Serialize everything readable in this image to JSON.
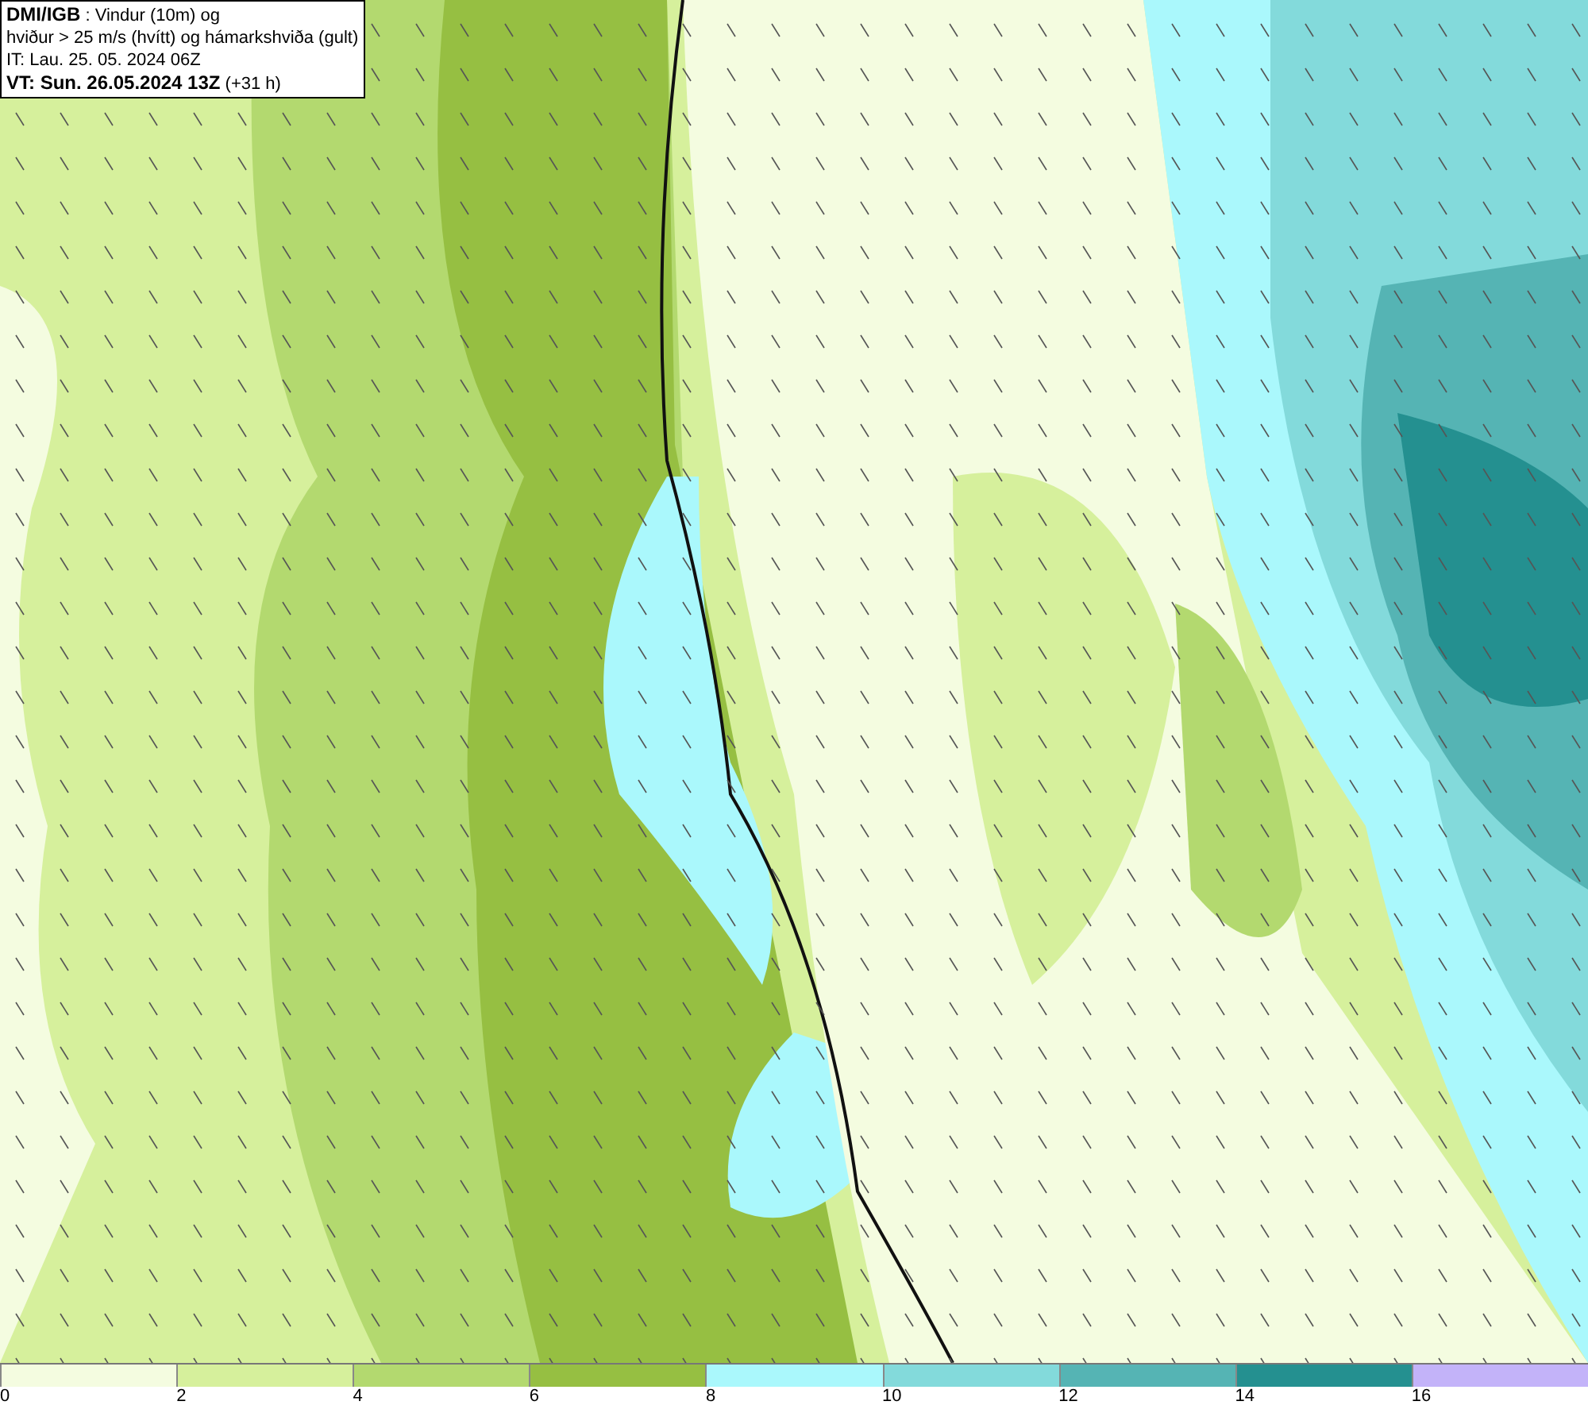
{
  "title_box": {
    "lines": [
      "**DMI/IGB** : Vindur (10m) og",
      "hviður > 25 m/s (hvítt) og hámarkshviða (gult)",
      "IT: Lau. 25. 05. 2024 06Z",
      "**VT: Sun. 26.05.2024 13Z** (+31 h)"
    ]
  },
  "legend": {
    "bins": [
      {
        "label": "0",
        "color": "#f4fce0"
      },
      {
        "label": "2",
        "color": "#d6f09c"
      },
      {
        "label": "4",
        "color": "#b3d96f"
      },
      {
        "label": "6",
        "color": "#96bf42"
      },
      {
        "label": "8",
        "color": "#aaf8fc"
      },
      {
        "label": "10",
        "color": "#83dadb"
      },
      {
        "label": "12",
        "color": "#55b4b4"
      },
      {
        "label": "14",
        "color": "#249090"
      },
      {
        "label": "16",
        "color": "#c3b3f9"
      }
    ]
  }
}
